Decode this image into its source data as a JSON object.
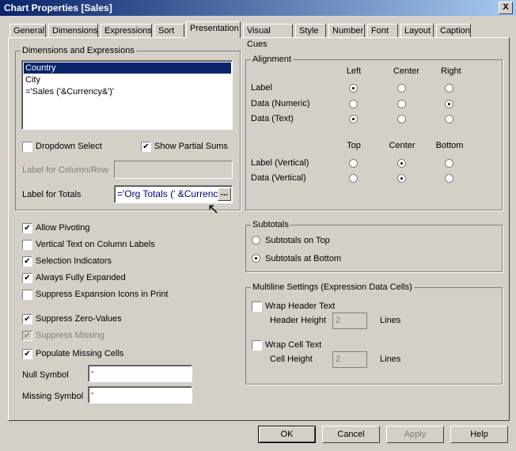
{
  "window": {
    "title": "Chart Properties [Sales]",
    "close": "X"
  },
  "tabs": [
    "General",
    "Dimensions",
    "Expressions",
    "Sort",
    "Presentation",
    "Visual Cues",
    "Style",
    "Number",
    "Font",
    "Layout",
    "Caption"
  ],
  "active_tab": "Presentation",
  "dims": {
    "label": "Dimensions and Expressions",
    "items": [
      "Country",
      "City",
      "='Sales ('&Currency&')'"
    ],
    "selected": "Country",
    "dropdown_select": {
      "label": "Dropdown Select",
      "checked": false
    },
    "show_partial_sums": {
      "label": "Show Partial Sums",
      "checked": true
    },
    "label_column_row": {
      "label": "Label for Column/Row",
      "value": ""
    },
    "label_totals": {
      "label": "Label for Totals",
      "value": "='Org Totals (' &Currency&')'",
      "display": "='Org Totals (' &Currenc",
      "more": "..."
    }
  },
  "alignment": {
    "label": "Alignment",
    "cols": [
      "Left",
      "Center",
      "Right"
    ],
    "rows": [
      {
        "label": "Label",
        "sel": 0
      },
      {
        "label": "Data (Numeric)",
        "sel": 2
      },
      {
        "label": "Data (Text)",
        "sel": 0
      }
    ],
    "vcols": [
      "Top",
      "Center",
      "Bottom"
    ],
    "vrows": [
      {
        "label": "Label (Vertical)",
        "sel": 1
      },
      {
        "label": "Data (Vertical)",
        "sel": 1
      }
    ]
  },
  "options": [
    {
      "label": "Allow Pivoting",
      "checked": true
    },
    {
      "label": "Vertical Text on Column Labels",
      "checked": false
    },
    {
      "label": "Selection Indicators",
      "checked": true
    },
    {
      "label": "Always Fully Expanded",
      "checked": true
    },
    {
      "label": "Suppress Expansion Icons in Print",
      "checked": false
    },
    {
      "label": "Suppress Zero-Values",
      "checked": true
    },
    {
      "label": "Suppress Missing",
      "checked": true,
      "disabled": true
    },
    {
      "label": "Populate Missing Cells",
      "checked": true
    }
  ],
  "null_symbol": {
    "label": "Null Symbol",
    "value": "-"
  },
  "missing_symbol": {
    "label": "Missing Symbol",
    "value": "-"
  },
  "subtotals": {
    "label": "Subtotals",
    "options": [
      "Subtotals on Top",
      "Subtotals at Bottom"
    ],
    "selected": 1
  },
  "multiline": {
    "label": "Multiline Settings (Expression Data Cells)",
    "wrap_header": {
      "label": "Wrap Header Text",
      "checked": false
    },
    "header_height": {
      "label": "Header Height",
      "value": "2",
      "unit": "Lines"
    },
    "wrap_cell": {
      "label": "Wrap Cell Text",
      "checked": false
    },
    "cell_height": {
      "label": "Cell Height",
      "value": "2",
      "unit": "Lines"
    }
  },
  "buttons": {
    "ok": "OK",
    "cancel": "Cancel",
    "apply": "Apply",
    "help": "Help"
  }
}
